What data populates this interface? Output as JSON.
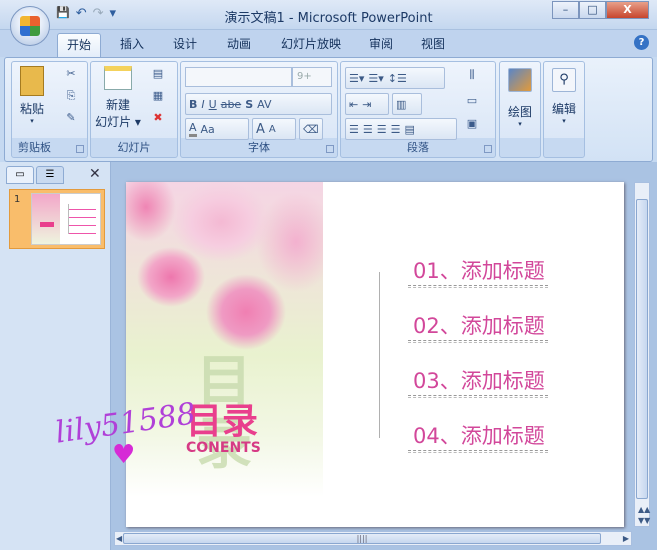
{
  "window": {
    "title": "演示文稿1 - Microsoft PowerPoint",
    "minimize": "–",
    "maximize": "□",
    "close": "X"
  },
  "qat": {
    "save": "💾",
    "undo": "↶",
    "redo": "↷",
    "customize": "▾"
  },
  "tabs": [
    "开始",
    "插入",
    "设计",
    "动画",
    "幻灯片放映",
    "审阅",
    "视图"
  ],
  "help": "?",
  "ribbon": {
    "clipboard": {
      "label": "剪贴板",
      "paste": "粘贴"
    },
    "slides": {
      "label": "幻灯片",
      "new_slide_1": "新建",
      "new_slide_2": "幻灯片"
    },
    "font": {
      "label": "字体",
      "font_name": "",
      "font_size": "9+",
      "bold": "B",
      "italic": "I",
      "underline": "U",
      "strike": "abe",
      "shadow": "S",
      "spacing": "AV",
      "color": "A",
      "case": "Aa",
      "grow": "A",
      "shrink": "A"
    },
    "paragraph": {
      "label": "段落"
    },
    "drawing": {
      "label": "绘图"
    },
    "editing": {
      "label": "编辑"
    }
  },
  "pane": {
    "close": "✕",
    "thumbnail_number": "1"
  },
  "slide": {
    "title": "目录",
    "subtitle": "CONENTS",
    "ghost_title": "目录",
    "items": [
      "01、添加标题",
      "02、添加标题",
      "03、添加标题",
      "04、添加标题"
    ]
  },
  "watermark": "lily51588",
  "colors": {
    "accent": "#d2479a",
    "ribbon": "#dbe7f7"
  }
}
